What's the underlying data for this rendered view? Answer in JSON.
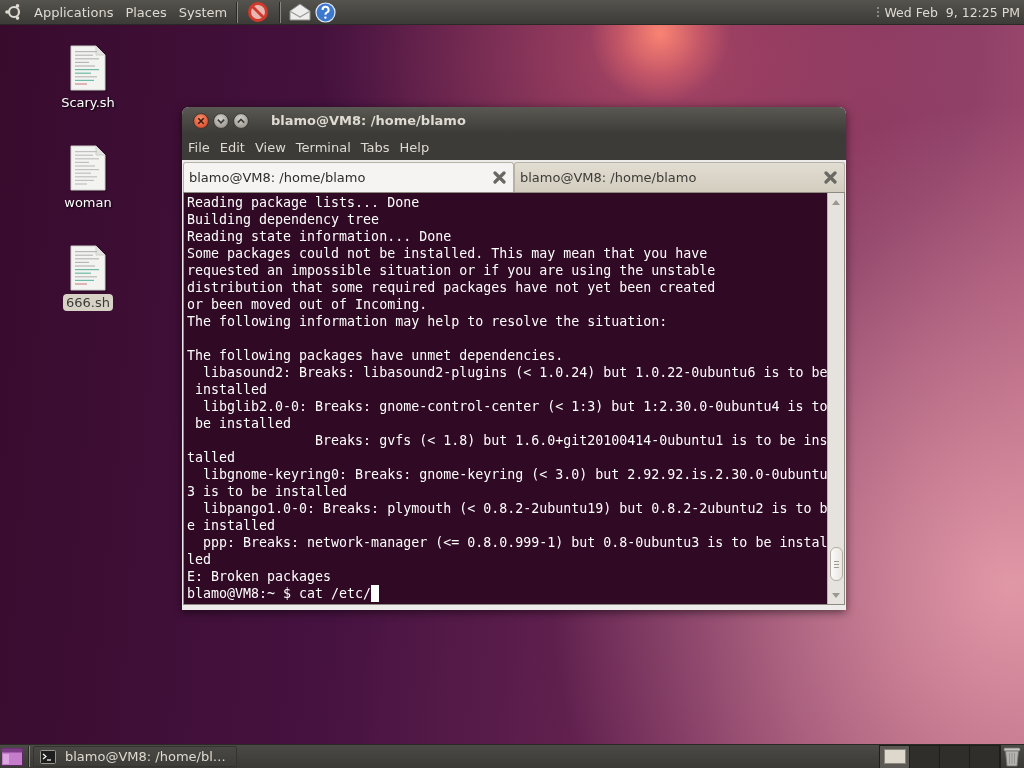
{
  "top_panel": {
    "menus": [
      "Applications",
      "Places",
      "System"
    ],
    "clock": "Wed Feb  9, 12:25 PM"
  },
  "desktop_icons": [
    {
      "label": "Scary.sh",
      "kind": "script",
      "selected": false
    },
    {
      "label": "woman",
      "kind": "text",
      "selected": false
    },
    {
      "label": "666.sh",
      "kind": "script",
      "selected": true
    }
  ],
  "window": {
    "title": "blamo@VM8: /home/blamo",
    "menu": [
      "File",
      "Edit",
      "View",
      "Terminal",
      "Tabs",
      "Help"
    ],
    "tabs": [
      {
        "label": "blamo@VM8: /home/blamo",
        "selected": true
      },
      {
        "label": "blamo@VM8: /home/blamo",
        "selected": false
      }
    ],
    "terminal": {
      "blocks": [
        [
          "Reading package lists... Done",
          "Building dependency tree",
          "Reading state information... Done",
          "Some packages could not be installed. This may mean that you have",
          "requested an impossible situation or if you are using the unstable",
          "distribution that some required packages have not yet been created",
          "or been moved out of Incoming.",
          "The following information may help to resolve the situation:"
        ],
        [
          "The following packages have unmet dependencies.",
          "  libasound2: Breaks: libasound2-plugins (< 1.0.24) but 1.0.22-0ubuntu6 is to be",
          " installed",
          "  libglib2.0-0: Breaks: gnome-control-center (< 1:3) but 1:2.30.0-0ubuntu4 is to",
          " be installed",
          "                Breaks: gvfs (< 1.8) but 1.6.0+git20100414-0ubuntu1 is to be ins",
          "talled",
          "  libgnome-keyring0: Breaks: gnome-keyring (< 3.0) but 2.92.92.is.2.30.0-0ubuntu",
          "3 is to be installed",
          "  libpango1.0-0: Breaks: plymouth (< 0.8.2-2ubuntu19) but 0.8.2-2ubuntu2 is to b",
          "e installed",
          "  ppp: Breaks: network-manager (<= 0.8.0.999-1) but 0.8-0ubuntu3 is to be instal",
          "led",
          "E: Broken packages"
        ]
      ],
      "prompt": "blamo@VM8:~ $ cat /etc/"
    }
  },
  "bottom_panel": {
    "tasks": [
      {
        "label": "blamo@VM8: /home/bl…"
      }
    ],
    "workspaces": [
      {
        "selected": true
      },
      {
        "selected": false
      },
      {
        "selected": false
      },
      {
        "selected": false
      }
    ]
  }
}
